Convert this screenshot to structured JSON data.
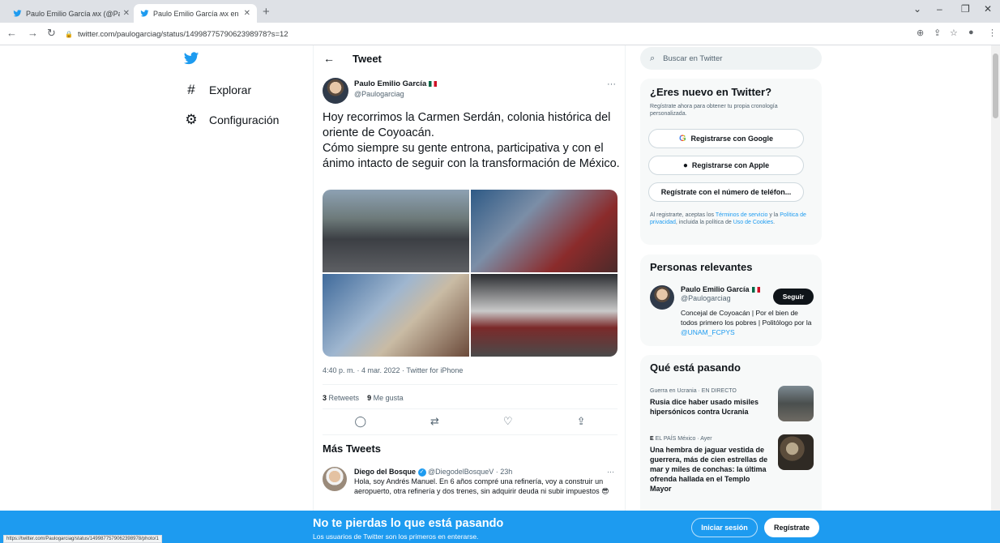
{
  "browser": {
    "tabs": [
      {
        "title": "Paulo Emilio García ʍx (@Paulog",
        "active": false
      },
      {
        "title": "Paulo Emilio García ʍx en Twitte",
        "active": true
      }
    ],
    "url": "twitter.com/paulogarciag/status/1499877579062398978?s=12",
    "status_url": "https://twitter.com/Paulogarciag/status/1499877579062398978/photo/1"
  },
  "left_nav": {
    "items": [
      {
        "label": "Explorar",
        "icon": "hash-icon"
      },
      {
        "label": "Configuración",
        "icon": "gear-icon"
      }
    ]
  },
  "tweet": {
    "header": "Tweet",
    "author_name": "Paulo Emilio García",
    "author_handle": "@Paulogarciag",
    "text": "Hoy recorrimos la Carmen Serdán, colonia histórica del oriente de Coyoacán.\nCómo siempre su gente entrona, participativa y con el ánimo intacto de seguir con la transformación de México.",
    "meta": "4:40 p. m. · 4 mar. 2022 · Twitter for iPhone",
    "retweets_count": "3",
    "retweets_label": "Retweets",
    "likes_count": "9",
    "likes_label": "Me gusta"
  },
  "more_tweets": {
    "title": "Más Tweets",
    "items": [
      {
        "name": "Diego del Bosque",
        "handle_time": "@DiegodelBosqueV · 23h",
        "text": "Hola, soy Andrés Manuel. En 6 años compré una refinería, voy a construir un aeropuerto, otra refinería y dos trenes, sin adquirir deuda ni subir impuestos 😎"
      }
    ]
  },
  "sidebar": {
    "search_placeholder": "Buscar en Twitter",
    "new_card": {
      "title": "¿Eres nuevo en Twitter?",
      "subtitle": "Regístrate ahora para obtener tu propia cronología personalizada.",
      "google_label": "Registrarse con Google",
      "apple_label": "Registrarse con Apple",
      "phone_label": "Regístrate con el número de teléfon...",
      "legal_prefix": "Al registrarte, aceptas los ",
      "legal_terms": "Términos de servicio",
      "legal_mid1": " y la ",
      "legal_privacy": "Política de privacidad",
      "legal_mid2": ", incluida la política de ",
      "legal_cookies": "Uso de Cookies",
      "legal_end": "."
    },
    "people_card": {
      "title": "Personas relevantes",
      "name": "Paulo Emilio García",
      "handle": "@Paulogarciag",
      "follow_label": "Seguir",
      "bio": "Conceјal de Coyoacán | Por el bien de todos primero los pobres | Politólogo por la ",
      "bio_link": "@UNAM_FCPYS"
    },
    "trends_card": {
      "title": "Qué está pasando",
      "items": [
        {
          "context": "Guerra en Ucrania · EN DIRECTO",
          "title": "Rusia dice haber usado misiles hipersónicos contra Ucrania"
        },
        {
          "context": "EL PAÍS México · Ayer",
          "title": "Una hembra de jaguar vestida de guerrera, más de cien estrellas de mar y miles de conchas: la última ofrenda hallada en el Templo Mayor"
        }
      ]
    }
  },
  "banner": {
    "title": "No te pierdas lo que está pasando",
    "subtitle": "Los usuarios de Twitter son los primeros en enterarse.",
    "login_label": "Iniciar sesión",
    "signup_label": "Regístrate"
  },
  "colors": {
    "accent": "#1d9bf0",
    "text": "#0f1419",
    "muted": "#536471"
  }
}
